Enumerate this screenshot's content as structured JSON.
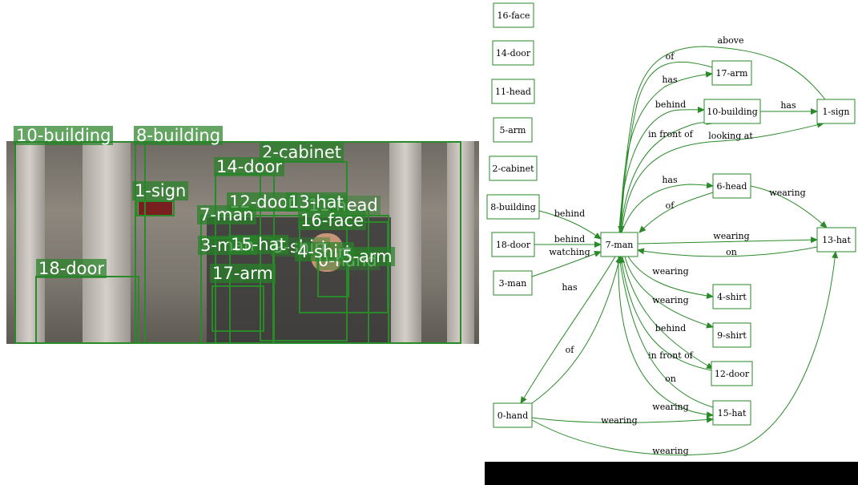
{
  "colors": {
    "accent": "#2a8a2a",
    "footer": "#000000"
  },
  "photo": {
    "labels": [
      {
        "id": "b10",
        "text": "10-building"
      },
      {
        "id": "b8",
        "text": "8-building"
      },
      {
        "id": "cab2",
        "text": "2-cabinet"
      },
      {
        "id": "door14",
        "text": "14-door"
      },
      {
        "id": "sign1",
        "text": "1-sign"
      },
      {
        "id": "door12",
        "text": "12-door"
      },
      {
        "id": "hat13",
        "text": "13-hat"
      },
      {
        "id": "head11",
        "text": "11-head"
      },
      {
        "id": "man7",
        "text": "7-man"
      },
      {
        "id": "face16",
        "text": "16-face"
      },
      {
        "id": "man3",
        "text": "3-man"
      },
      {
        "id": "hat15",
        "text": "15-hat"
      },
      {
        "id": "shirt9",
        "text": "9-shirt"
      },
      {
        "id": "shirt4",
        "text": "4-shirt"
      },
      {
        "id": "hand0",
        "text": "0-hand"
      },
      {
        "id": "arm5",
        "text": "5-arm"
      },
      {
        "id": "door18",
        "text": "18-door"
      },
      {
        "id": "arm17",
        "text": "17-arm"
      }
    ]
  },
  "graph": {
    "nodes": [
      {
        "id": "16-face",
        "label": "16-face"
      },
      {
        "id": "14-door",
        "label": "14-door"
      },
      {
        "id": "11-head",
        "label": "11-head"
      },
      {
        "id": "5-arm",
        "label": "5-arm"
      },
      {
        "id": "2-cabinet",
        "label": "2-cabinet"
      },
      {
        "id": "8-building",
        "label": "8-building"
      },
      {
        "id": "18-door",
        "label": "18-door"
      },
      {
        "id": "3-man",
        "label": "3-man"
      },
      {
        "id": "0-hand",
        "label": "0-hand"
      },
      {
        "id": "7-man",
        "label": "7-man"
      },
      {
        "id": "17-arm",
        "label": "17-arm"
      },
      {
        "id": "10-building",
        "label": "10-building"
      },
      {
        "id": "6-head",
        "label": "6-head"
      },
      {
        "id": "4-shirt",
        "label": "4-shirt"
      },
      {
        "id": "9-shirt",
        "label": "9-shirt"
      },
      {
        "id": "12-door",
        "label": "12-door"
      },
      {
        "id": "15-hat",
        "label": "15-hat"
      },
      {
        "id": "1-sign",
        "label": "1-sign"
      },
      {
        "id": "13-hat",
        "label": "13-hat"
      }
    ],
    "edges": [
      {
        "id": "e-above",
        "from": "1-sign",
        "to": "7-man",
        "label": "above"
      },
      {
        "id": "e-of-17",
        "from": "17-arm",
        "to": "7-man",
        "label": "of"
      },
      {
        "id": "e-has-17",
        "from": "7-man",
        "to": "17-arm",
        "label": "has"
      },
      {
        "id": "e-behind-10",
        "from": "7-man",
        "to": "10-building",
        "label": "behind"
      },
      {
        "id": "e-has-sign",
        "from": "10-building",
        "to": "1-sign",
        "label": "has"
      },
      {
        "id": "e-infront-10",
        "from": "7-man",
        "to": "10-building",
        "label": "in front of"
      },
      {
        "id": "e-looking",
        "from": "7-man",
        "to": "1-sign",
        "label": "looking at"
      },
      {
        "id": "e-has-6",
        "from": "7-man",
        "to": "6-head",
        "label": "has"
      },
      {
        "id": "e-of-6",
        "from": "6-head",
        "to": "7-man",
        "label": "of"
      },
      {
        "id": "e-wearing-6",
        "from": "6-head",
        "to": "13-hat",
        "label": "wearing"
      },
      {
        "id": "e-behind-8",
        "from": "8-building",
        "to": "7-man",
        "label": "behind"
      },
      {
        "id": "e-behind-18",
        "from": "18-door",
        "to": "7-man",
        "label": "behind"
      },
      {
        "id": "e-watching",
        "from": "3-man",
        "to": "7-man",
        "label": "watching"
      },
      {
        "id": "e-wearing-13",
        "from": "7-man",
        "to": "13-hat",
        "label": "wearing"
      },
      {
        "id": "e-on-13",
        "from": "13-hat",
        "to": "7-man",
        "label": "on"
      },
      {
        "id": "e-has-0",
        "from": "7-man",
        "to": "0-hand",
        "label": "has"
      },
      {
        "id": "e-of-0",
        "from": "0-hand",
        "to": "7-man",
        "label": "of"
      },
      {
        "id": "e-wearing-4",
        "from": "7-man",
        "to": "4-shirt",
        "label": "wearing"
      },
      {
        "id": "e-wearing-9",
        "from": "7-man",
        "to": "9-shirt",
        "label": "wearing"
      },
      {
        "id": "e-behind-12",
        "from": "7-man",
        "to": "12-door",
        "label": "behind"
      },
      {
        "id": "e-infront-12",
        "from": "12-door",
        "to": "7-man",
        "label": "in front of"
      },
      {
        "id": "e-on-15",
        "from": "15-hat",
        "to": "7-man",
        "label": "on"
      },
      {
        "id": "e-wearing-15",
        "from": "7-man",
        "to": "15-hat",
        "label": "wearing"
      },
      {
        "id": "e-wearing-0-15",
        "from": "0-hand",
        "to": "15-hat",
        "label": "wearing"
      },
      {
        "id": "e-wearing-0-13",
        "from": "0-hand",
        "to": "13-hat",
        "label": "wearing"
      }
    ]
  }
}
